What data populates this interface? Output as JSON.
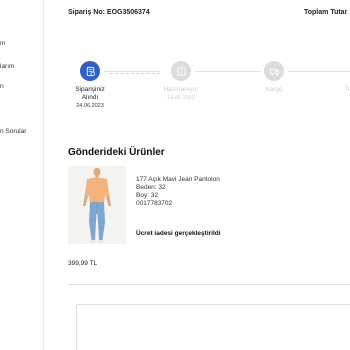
{
  "sidebar": {
    "items": [
      {
        "label": "m"
      },
      {
        "label": "larım"
      },
      {
        "label": "rı"
      },
      {
        "label": "n Sorular"
      }
    ]
  },
  "order": {
    "number_label": "Sipariş No: EOG3506374",
    "total_label": "Toplam Tutar"
  },
  "steps": [
    {
      "label_line1": "Siparişiniz",
      "label_line2": "Alındı",
      "date": "24.06.2023",
      "state": "active",
      "icon": "document-icon"
    },
    {
      "label_line1": "Hazırlanıyor",
      "label_line2": "",
      "date": "24.06.2023",
      "state": "inactive",
      "icon": "package-icon"
    },
    {
      "label_line1": "Kargo",
      "label_line2": "",
      "date": "",
      "state": "inactive",
      "icon": "truck-icon"
    },
    {
      "label_line1": "Te",
      "label_line2": "",
      "date": "",
      "state": "inactive",
      "icon": ""
    }
  ],
  "section": {
    "title": "Gönderideki Ürünler"
  },
  "product": {
    "name": "177 Açık Mavi Jean Pantolon",
    "size": "Beden: 32",
    "length": "Boy: 32",
    "sku": "0017783702",
    "refund_status": "Ücret iadesi gerçekleştirildi",
    "price": "399,99 TL"
  },
  "colors": {
    "accent": "#2f5fc9",
    "inactive": "#dcdcdc"
  }
}
